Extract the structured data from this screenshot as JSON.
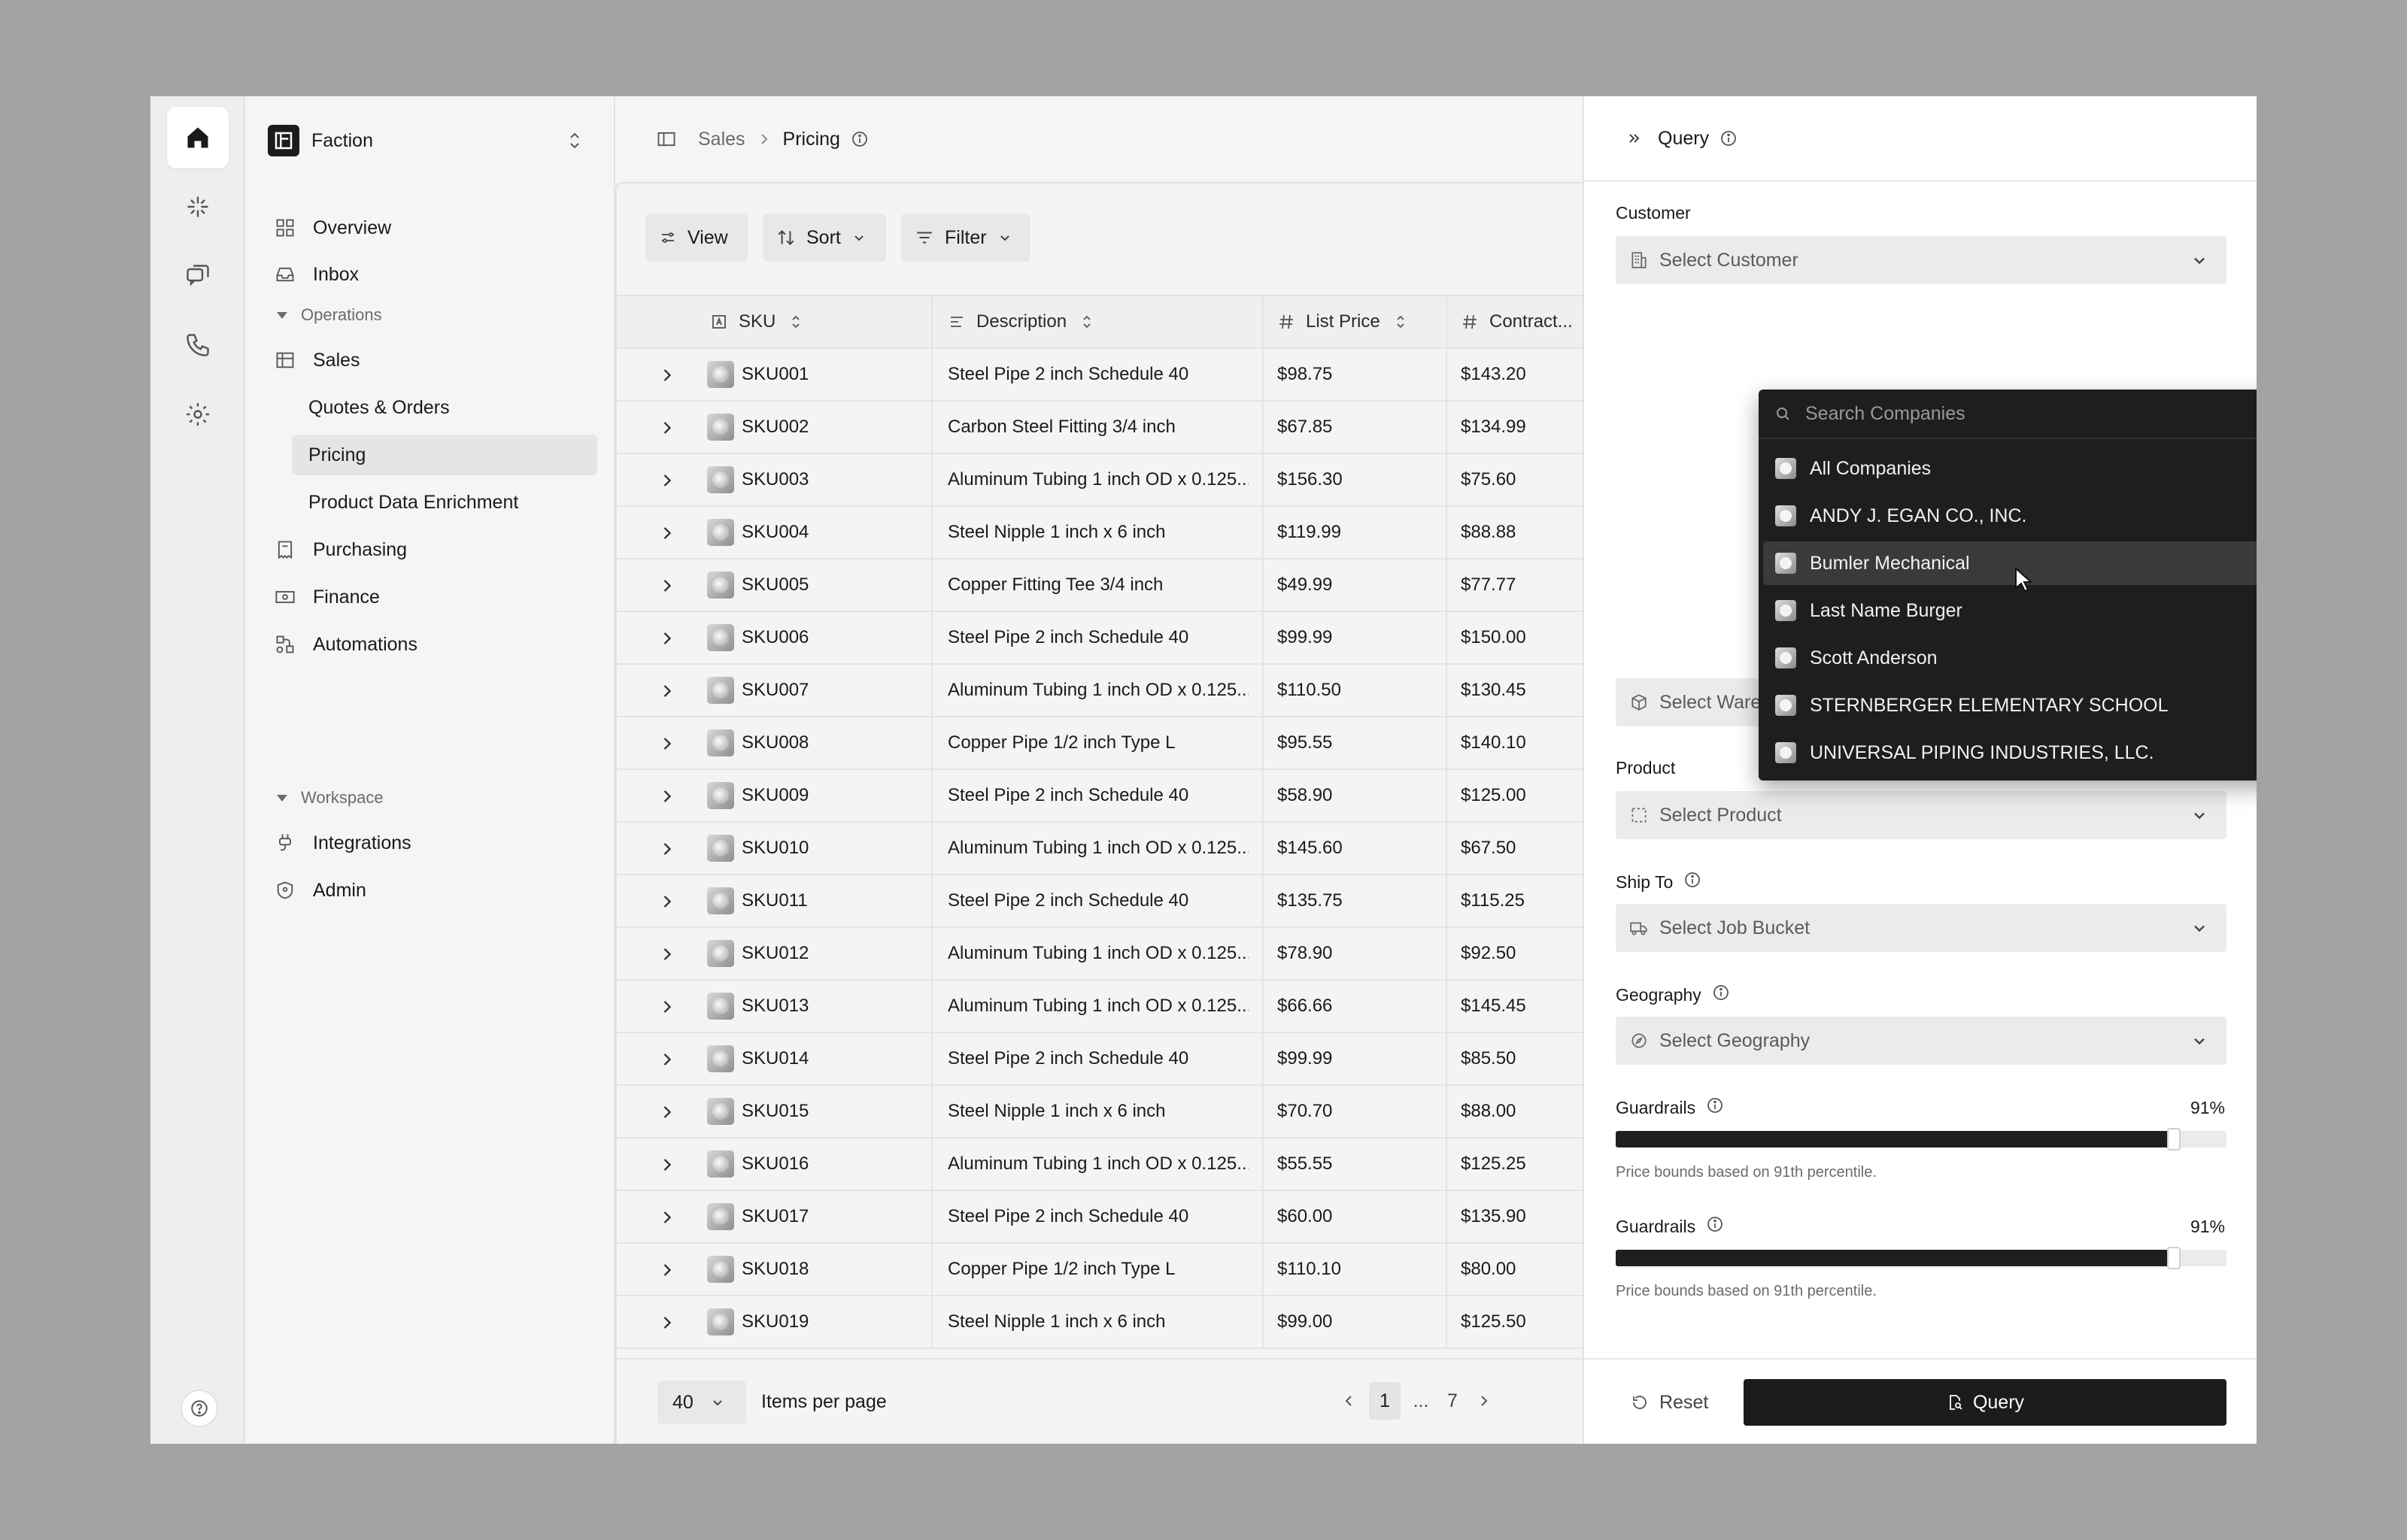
{
  "rail": {
    "icons": [
      "home-icon",
      "sparkle-icon",
      "chat-icon",
      "phone-icon",
      "settings-icon",
      "help-icon"
    ]
  },
  "sidebar": {
    "workspace_name": "Faction",
    "top_items": [
      {
        "label": "Overview",
        "icon": "grid-icon"
      },
      {
        "label": "Inbox",
        "icon": "inbox-icon"
      }
    ],
    "operations_label": "Operations",
    "operations": [
      {
        "label": "Sales",
        "icon": "table-icon"
      },
      {
        "label": "Quotes & Orders"
      },
      {
        "label": "Pricing",
        "selected": true
      },
      {
        "label": "Product Data Enrichment"
      },
      {
        "label": "Purchasing",
        "icon": "receipt-icon"
      },
      {
        "label": "Finance",
        "icon": "banknote-icon"
      },
      {
        "label": "Automations",
        "icon": "workflow-icon"
      }
    ],
    "workspace_label": "Workspace",
    "workspace_items": [
      {
        "label": "Integrations",
        "icon": "plug-icon"
      },
      {
        "label": "Admin",
        "icon": "shield-icon"
      }
    ]
  },
  "breadcrumb": {
    "parent": "Sales",
    "current": "Pricing"
  },
  "toolbar": {
    "view": "View",
    "sort": "Sort",
    "filter": "Filter"
  },
  "table": {
    "columns": [
      "SKU",
      "Description",
      "List Price",
      "Contract..."
    ],
    "rows": [
      [
        "SKU001",
        "Steel Pipe 2 inch Schedule 40",
        "$98.75",
        "$143.20"
      ],
      [
        "SKU002",
        "Carbon Steel Fitting 3/4 inch",
        "$67.85",
        "$134.99"
      ],
      [
        "SKU003",
        "Aluminum Tubing 1 inch OD x 0.125...",
        "$156.30",
        "$75.60"
      ],
      [
        "SKU004",
        "Steel Nipple 1 inch x 6 inch",
        "$119.99",
        "$88.88"
      ],
      [
        "SKU005",
        "Copper Fitting Tee 3/4 inch",
        "$49.99",
        "$77.77"
      ],
      [
        "SKU006",
        "Steel Pipe 2 inch Schedule 40",
        "$99.99",
        "$150.00"
      ],
      [
        "SKU007",
        "Aluminum Tubing 1 inch OD x 0.125...",
        "$110.50",
        "$130.45"
      ],
      [
        "SKU008",
        "Copper Pipe 1/2 inch Type L",
        "$95.55",
        "$140.10"
      ],
      [
        "SKU009",
        "Steel Pipe 2 inch Schedule 40",
        "$58.90",
        "$125.00"
      ],
      [
        "SKU010",
        "Aluminum Tubing 1 inch OD x 0.125...",
        "$145.60",
        "$67.50"
      ],
      [
        "SKU011",
        "Steel Pipe 2 inch Schedule 40",
        "$135.75",
        "$115.25"
      ],
      [
        "SKU012",
        "Aluminum Tubing 1 inch OD x 0.125...",
        "$78.90",
        "$92.50"
      ],
      [
        "SKU013",
        "Aluminum Tubing 1 inch OD x 0.125...",
        "$66.66",
        "$145.45"
      ],
      [
        "SKU014",
        "Steel Pipe 2 inch Schedule 40",
        "$99.99",
        "$85.50"
      ],
      [
        "SKU015",
        "Steel Nipple 1 inch x 6 inch",
        "$70.70",
        "$88.00"
      ],
      [
        "SKU016",
        "Aluminum Tubing 1 inch OD x 0.125...",
        "$55.55",
        "$125.25"
      ],
      [
        "SKU017",
        "Steel Pipe 2 inch Schedule 40",
        "$60.00",
        "$135.90"
      ],
      [
        "SKU018",
        "Copper Pipe 1/2 inch Type L",
        "$110.10",
        "$80.00"
      ],
      [
        "SKU019",
        "Steel Nipple 1 inch x 6 inch",
        "$99.00",
        "$125.50"
      ]
    ]
  },
  "pagination": {
    "per_page": "40",
    "per_page_label": "Items per page",
    "current_page": "1",
    "ellipsis": "...",
    "last_page": "7"
  },
  "query_panel": {
    "title": "Query",
    "customer_label": "Customer",
    "customer_placeholder": "Select Customer",
    "warehouse_placeholder": "Select Warehouse",
    "product_label": "Product",
    "product_placeholder": "Select Product",
    "ship_to_label": "Ship To",
    "ship_to_placeholder": "Select Job Bucket",
    "geography_label": "Geography",
    "geography_placeholder": "Select Geography",
    "guardrails": [
      {
        "label": "Guardrails",
        "value": 0.91,
        "value_text": "91%",
        "hint": "Price bounds based on 91th percentile."
      },
      {
        "label": "Guardrails",
        "value": 0.91,
        "value_text": "91%",
        "hint": "Price bounds based on 91th percentile."
      }
    ],
    "reset_label": "Reset",
    "query_label": "Query"
  },
  "customer_dropdown": {
    "search_placeholder": "Search Companies",
    "items": [
      "All Companies",
      "ANDY J. EGAN CO., INC.",
      "Bumler Mechanical",
      "Last Name Burger",
      "Scott Anderson",
      "STERNBERGER ELEMENTARY SCHOOL",
      "UNIVERSAL PIPING INDUSTRIES, LLC."
    ],
    "highlighted": "Bumler Mechanical"
  }
}
